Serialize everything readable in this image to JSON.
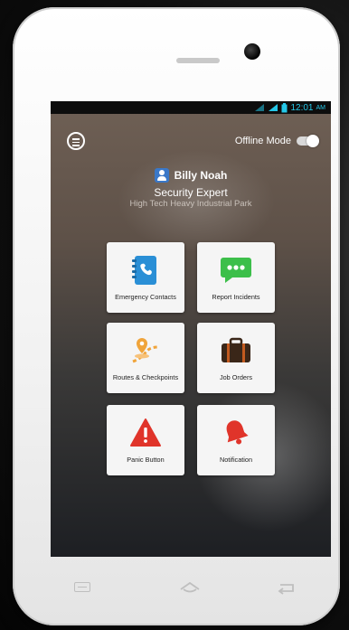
{
  "status_bar": {
    "time": "12:01",
    "ampm": "AM",
    "icons": [
      "wifi-icon",
      "signal-icon",
      "battery-icon"
    ]
  },
  "header": {
    "offline_mode_label": "Offline Mode",
    "offline_mode_on": false
  },
  "user": {
    "name": "Billy Noah",
    "role": "Security Expert",
    "location": "High Tech Heavy Industrial Park"
  },
  "tiles": [
    {
      "label": "Emergency Contacts",
      "icon": "contacts-book-icon",
      "color": "#2a8fd6"
    },
    {
      "label": "Report Incidents",
      "icon": "chat-bubble-icon",
      "color": "#3cbf4a"
    },
    {
      "label": "Routes & Checkpoints",
      "icon": "route-pin-icon",
      "color": "#f0a43a"
    },
    {
      "label": "Job Orders",
      "icon": "briefcase-icon",
      "color": "#3a2618"
    },
    {
      "label": "Panic Button",
      "icon": "warning-triangle-icon",
      "color": "#e0342a"
    },
    {
      "label": "Notification",
      "icon": "bell-icon",
      "color": "#e0342a"
    }
  ],
  "colors": {
    "status_accent": "#25c7e8",
    "tile_background": "#f5f5f5"
  }
}
